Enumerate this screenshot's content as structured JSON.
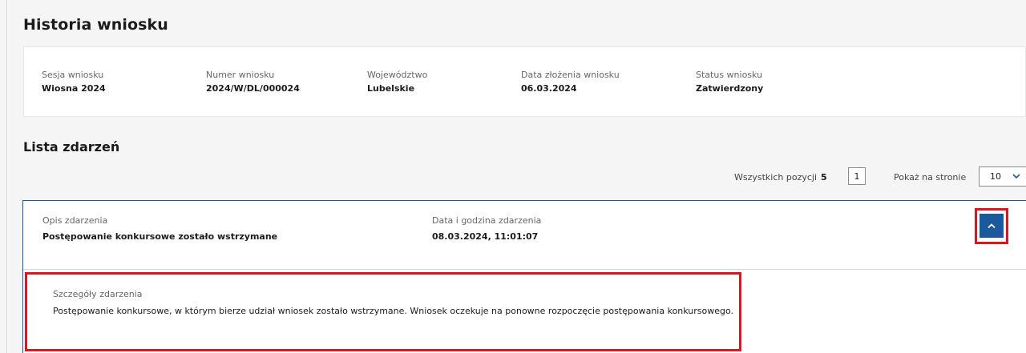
{
  "page": {
    "title": "Historia wniosku"
  },
  "summary": {
    "fields": [
      {
        "label": "Sesja wniosku",
        "value": "Wiosna 2024"
      },
      {
        "label": "Numer wniosku",
        "value": "2024/W/DL/000024"
      },
      {
        "label": "Województwo",
        "value": "Lubelskie"
      },
      {
        "label": "Data złożenia wniosku",
        "value": "06.03.2024"
      },
      {
        "label": "Status wniosku",
        "value": "Zatwierdzony"
      }
    ]
  },
  "events": {
    "title": "Lista zdarzeń",
    "total_label": "Wszystkich pozycji",
    "total_count": "5",
    "current_page": "1",
    "per_page_label": "Pokaż na stronie",
    "per_page_value": "10",
    "icons": {
      "per_page_select": "chevron-down-icon",
      "toggle": "chevron-up-icon"
    },
    "accent_color": "#1a5a9c",
    "highlight_color": "#e0141e",
    "items": [
      {
        "description_label": "Opis zdarzenia",
        "description": "Postępowanie konkursowe zostało wstrzymane",
        "datetime_label": "Data i godzina zdarzenia",
        "datetime": "08.03.2024, 11:01:07",
        "details_label": "Szczegóły zdarzenia",
        "details": "Postępowanie konkursowe, w którym bierze udział wniosek zostało wstrzymane. Wniosek oczekuje na ponowne rozpoczęcie postępowania konkursowego."
      }
    ]
  }
}
